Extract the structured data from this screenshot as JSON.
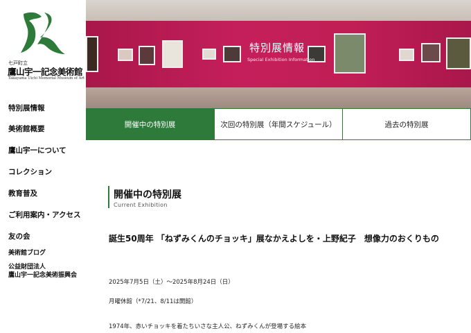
{
  "logo": {
    "mark_icon": "tk-green-brush-logo",
    "small": "七戸町立",
    "name": "鷹山宇一記念美術館",
    "english": "Takayama Uichi Memorial Museum of Art"
  },
  "nav": {
    "items": [
      {
        "label": "特別展情報"
      },
      {
        "label": "美術館概要"
      },
      {
        "label": "鷹山宇一について"
      },
      {
        "label": "コレクション"
      },
      {
        "label": "教育普及"
      },
      {
        "label": "ご利用案内・アクセス"
      },
      {
        "label": "友の会"
      },
      {
        "label": "美術館ブログ"
      },
      {
        "label": "公益財団法人"
      },
      {
        "label": "鷹山宇一記念美術振興会"
      }
    ]
  },
  "hero": {
    "title": "特別展情報",
    "subtitle": "Special Exhibition Information"
  },
  "tabs": [
    {
      "label": "開催中の特別展"
    },
    {
      "label": "次回の特別展（年間スケジュール）"
    },
    {
      "label": "過去の特別展"
    }
  ],
  "section": {
    "title": "開催中の特別展",
    "subtitle": "Current Exhibition"
  },
  "exhibition": {
    "title": "誕生50周年 「ねずみくんのチョッキ」展なかえよしを・上野紀子　想像力のおくりもの",
    "dates": "2025年7月5日（土）～2025年8月24日（日）",
    "closed": "月曜休館（*7/21、8/11は開館）",
    "description": "1974年、赤いチョッキを着たちいさな主人公、ねずみくんが登場する絵本"
  },
  "colors": {
    "accent_green": "#2d7a3a",
    "wall_magenta": "#c01e55"
  }
}
